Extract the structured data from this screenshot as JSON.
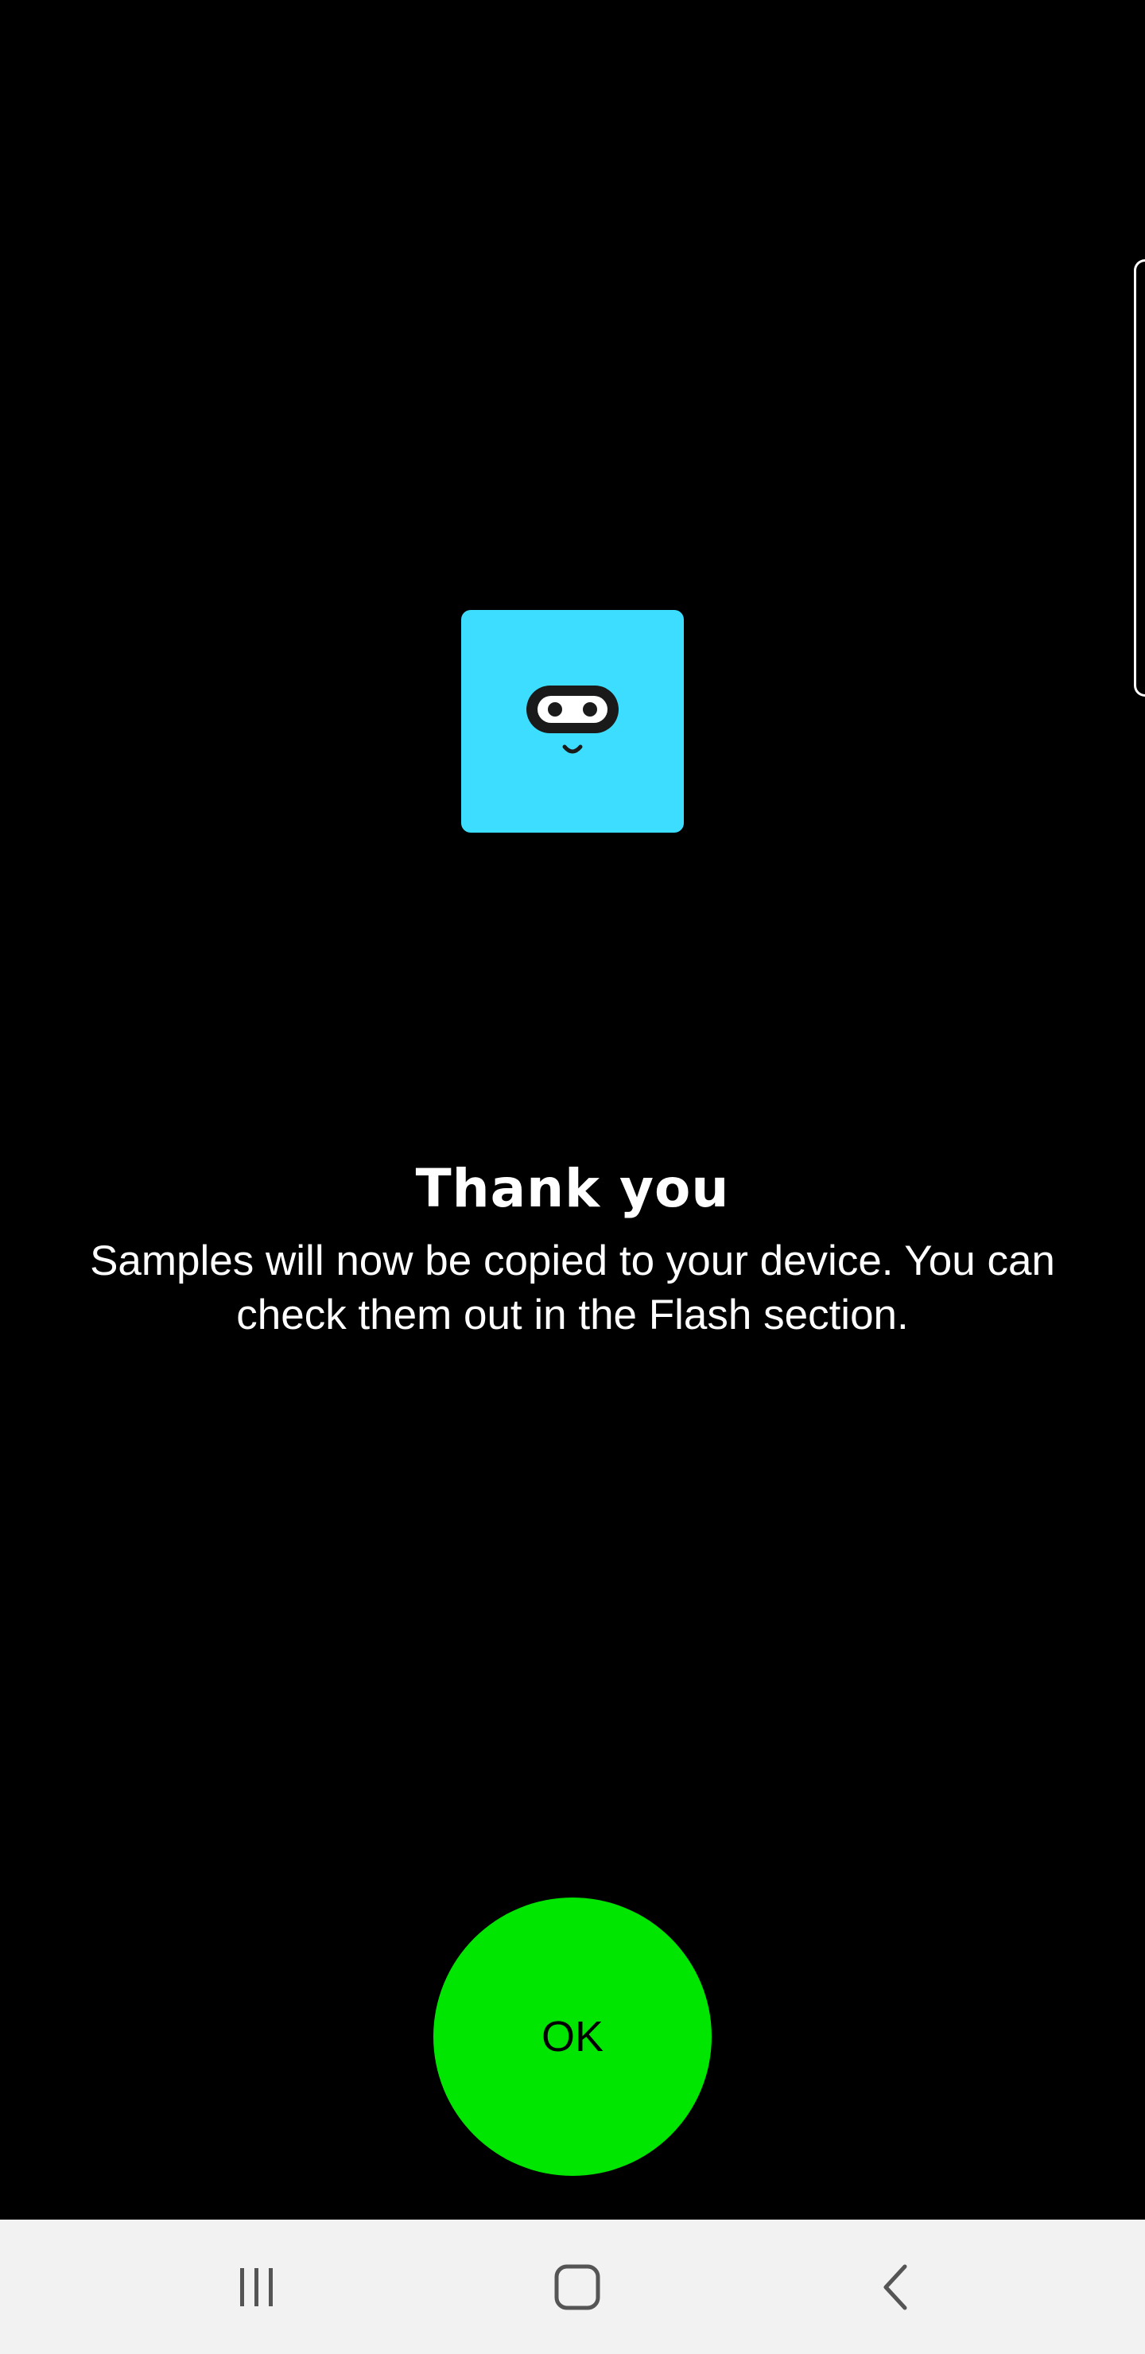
{
  "dialog": {
    "title": "Thank you",
    "message": "Samples will now be copied to your device. You can check them out in the Flash section.",
    "ok_label": "OK",
    "logo_icon": "microbit-face-icon"
  },
  "colors": {
    "background": "#000000",
    "logo_tile": "#3dddff",
    "ok_button": "#00e600",
    "nav_bar": "#f2f2f2",
    "nav_icon": "#555555"
  },
  "navigation_bar": {
    "buttons": [
      {
        "icon": "recents-icon"
      },
      {
        "icon": "home-icon"
      },
      {
        "icon": "back-icon"
      }
    ]
  }
}
